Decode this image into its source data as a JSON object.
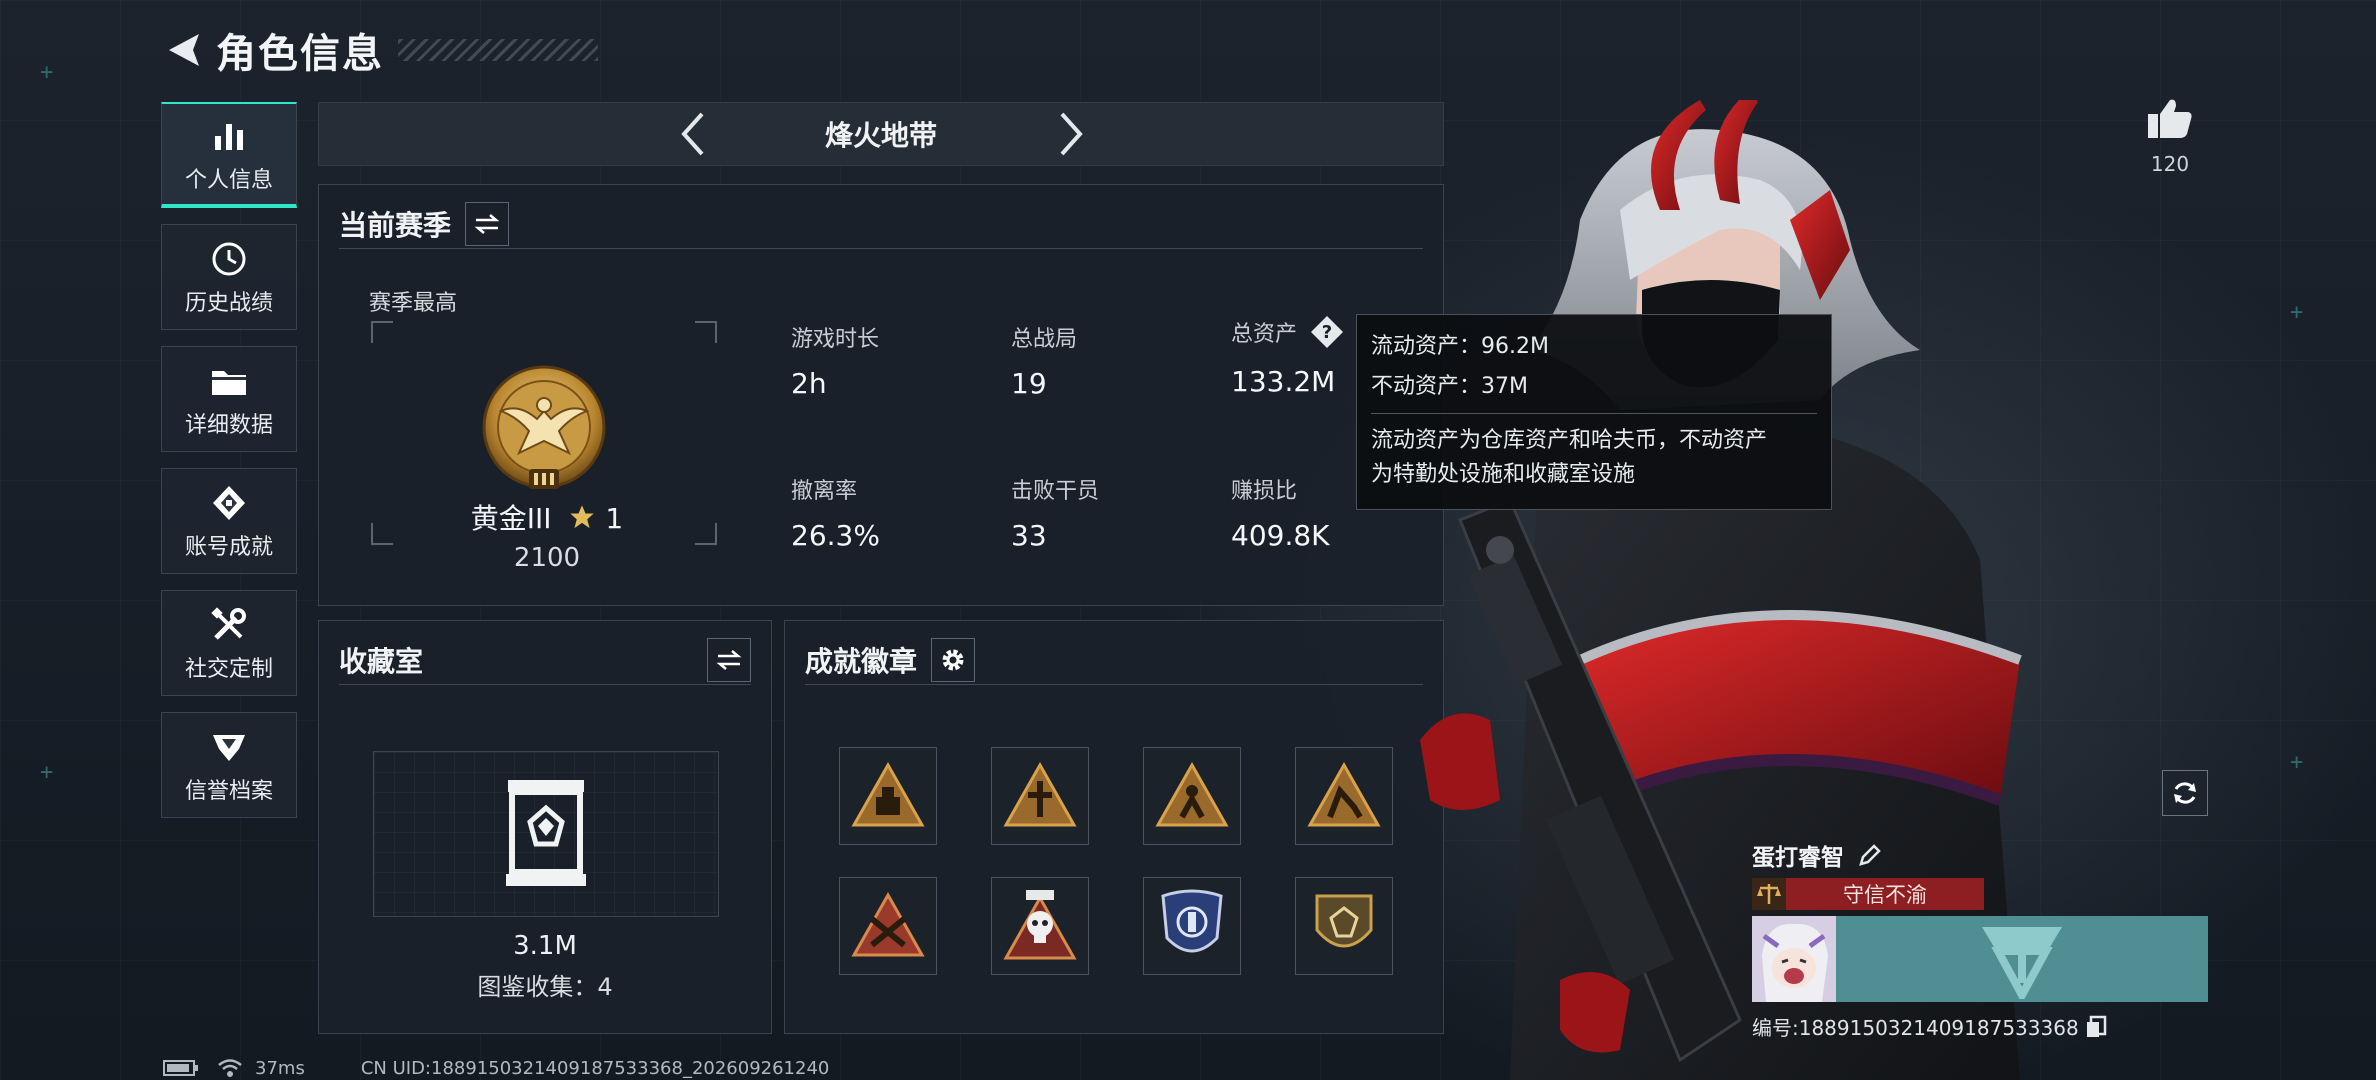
{
  "header": {
    "title": "角色信息"
  },
  "sidebar": {
    "items": [
      {
        "label": "个人信息",
        "icon": "bar-chart-icon",
        "active": true
      },
      {
        "label": "历史战绩",
        "icon": "clock-icon"
      },
      {
        "label": "详细数据",
        "icon": "folder-icon"
      },
      {
        "label": "账号成就",
        "icon": "achievement-icon"
      },
      {
        "label": "社交定制",
        "icon": "tools-icon"
      },
      {
        "label": "信誉档案",
        "icon": "shield-emblem-icon"
      }
    ]
  },
  "mode": {
    "title": "烽火地带"
  },
  "season": {
    "title": "当前赛季",
    "best_label": "赛季最高",
    "rank_name": "黄金III",
    "rank_stars": "1",
    "rank_score": "2100",
    "stats": {
      "play_time": {
        "label": "游戏时长",
        "value": "2h"
      },
      "total_matches": {
        "label": "总战局",
        "value": "19"
      },
      "total_assets": {
        "label": "总资产",
        "value": "133.2M"
      },
      "extract_rate": {
        "label": "撤离率",
        "value": "26.3%"
      },
      "kills": {
        "label": "击败干员",
        "value": "33"
      },
      "profit_ratio": {
        "label": "赚损比",
        "value": "409.8K"
      }
    }
  },
  "tooltip": {
    "liquid": "流动资产：96.2M",
    "fixed": "不动资产：37M",
    "desc_line1": "流动资产为仓库资产和哈夫币，不动资产",
    "desc_line2": "为特勤处设施和收藏室设施"
  },
  "collection": {
    "title": "收藏室",
    "value": "3.1M",
    "count_text": "图鉴收集：4"
  },
  "badges": {
    "title": "成就徽章",
    "items": [
      "triangle-badge",
      "triangle-badge",
      "triangle-badge",
      "triangle-badge",
      "triangle-badge",
      "skull-badge",
      "police-shield-badge",
      "gem-shield-badge"
    ]
  },
  "likes": {
    "count": "120"
  },
  "player": {
    "name": "蛋打睿智",
    "title": "守信不渝",
    "uid_text": "编号:1889150321409187533368"
  },
  "footer": {
    "ping": "37ms",
    "uid_line": "CN UID:1889150321409187533368_202609261240"
  },
  "colors": {
    "accent": "#2fe6c8",
    "gold": "#c8a24a",
    "title_red": "#8d1f22"
  }
}
